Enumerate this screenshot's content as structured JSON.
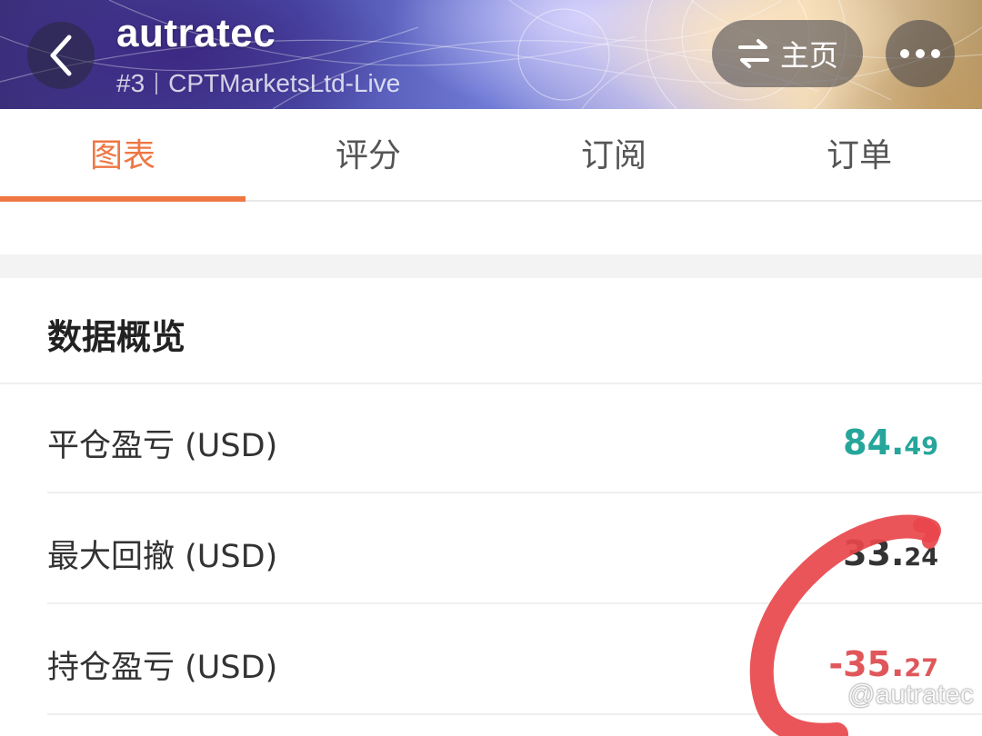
{
  "header": {
    "back_icon": "chevron-left-icon",
    "title": "autratec",
    "account_number": "#3",
    "server": "CPTMarketsLtd-Live",
    "home_button_label": "主页",
    "home_button_icon": "swap-arrows-icon",
    "more_icon": "more-dots-icon"
  },
  "tabs": [
    {
      "label": "图表",
      "active": true
    },
    {
      "label": "评分",
      "active": false
    },
    {
      "label": "订阅",
      "active": false
    },
    {
      "label": "订单",
      "active": false
    }
  ],
  "overview": {
    "title": "数据概览",
    "rows": [
      {
        "label": "平仓盈亏 (USD)",
        "value_int": "84.",
        "value_dec": "49",
        "color": "#26a69a"
      },
      {
        "label": "最大回撤 (USD)",
        "value_int": "33.",
        "value_dec": "24",
        "color": "#333333"
      },
      {
        "label": "持仓盈亏 (USD)",
        "value_int": "-35.",
        "value_dec": "27",
        "color": "#e0575b"
      }
    ]
  },
  "annotation": {
    "marker_color": "#e8474c"
  },
  "watermark": {
    "logo_icon": "zhihu-logo-icon",
    "text": "@autratec"
  },
  "colors": {
    "accent": "#ee7744",
    "profit": "#26a69a",
    "loss": "#e0575b"
  }
}
